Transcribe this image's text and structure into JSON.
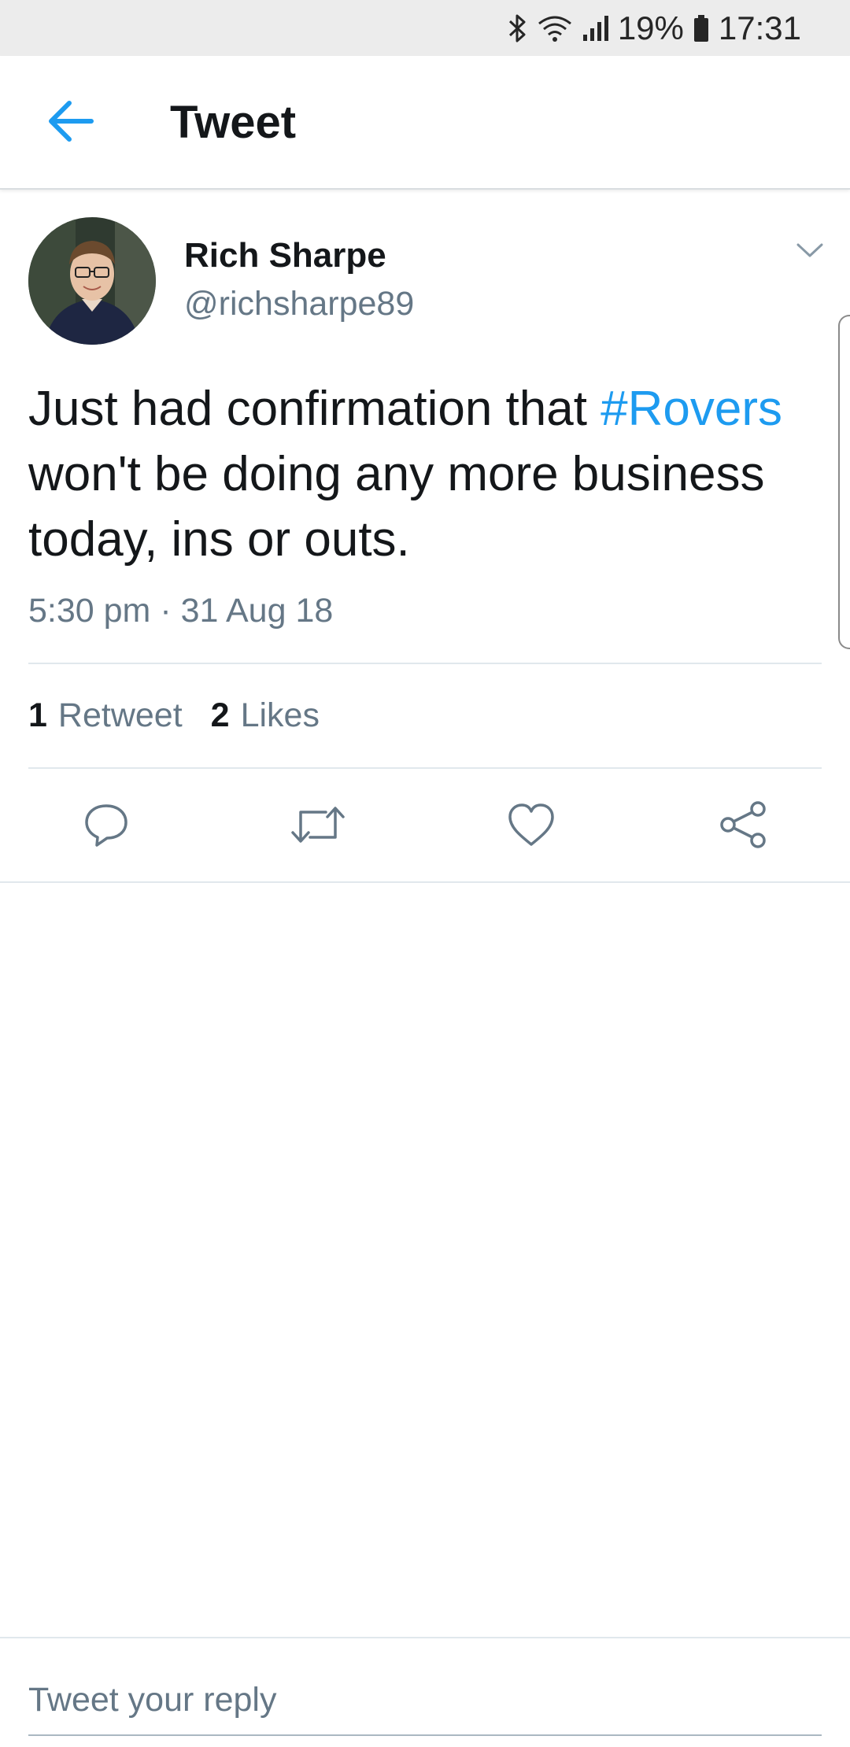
{
  "status_bar": {
    "battery": "19%",
    "time": "17:31",
    "icons": [
      "bluetooth-icon",
      "wifi-icon",
      "signal-icon",
      "battery-icon"
    ]
  },
  "app_bar": {
    "title": "Tweet",
    "back_icon": "back-arrow-icon"
  },
  "tweet": {
    "author_name": "Rich Sharpe",
    "author_handle": "@richsharpe89",
    "text_before": "Just had confirmation that ",
    "hashtag": "#Rovers",
    "text_after": " won't be doing any more business today, ins or outs.",
    "timestamp": "5:30 pm · 31 Aug 18",
    "retweet_count": "1",
    "retweet_label": "Retweet",
    "like_count": "2",
    "like_label": "Likes"
  },
  "actions": [
    "reply-icon",
    "retweet-icon",
    "like-icon",
    "share-icon"
  ],
  "reply": {
    "placeholder": "Tweet your reply"
  },
  "colors": {
    "accent": "#1d9bf0",
    "text_primary": "#14171a",
    "text_secondary": "#657786",
    "divider": "#e1e8ed"
  }
}
